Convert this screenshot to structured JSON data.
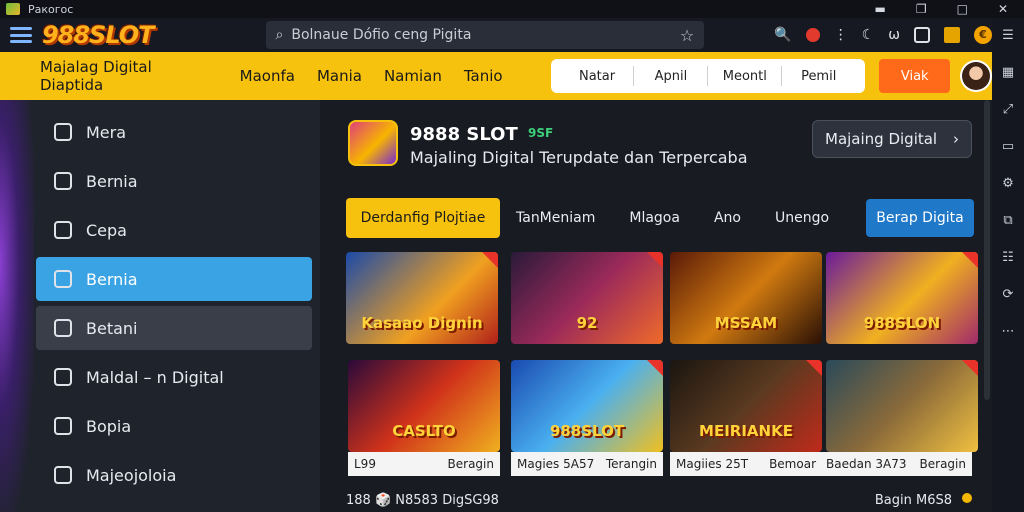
{
  "window": {
    "title": "Ракoгос",
    "controls": [
      "▬",
      "❐",
      "□",
      "✕"
    ]
  },
  "browser": {
    "logo": "988SLOT",
    "url_placeholder": "Bolnaue Dófio ceng Pigita",
    "star": "☆",
    "tools": [
      "🔍",
      "⋮",
      "☾",
      "ω"
    ]
  },
  "topnav": {
    "brand_text": "Majalag Digital Diaptida",
    "items": [
      "Maonfa",
      "Mania",
      "Namian",
      "Tanio"
    ],
    "pill": [
      "Natar",
      "Apnil",
      "Meontl",
      "Pemil"
    ],
    "cta": "Viak"
  },
  "sidebar": {
    "items": [
      {
        "label": "Mera"
      },
      {
        "label": "Bernia"
      },
      {
        "label": "Cepa"
      },
      {
        "label": "Bernia"
      },
      {
        "label": "Betani"
      },
      {
        "label": "Maldal – n Digital"
      },
      {
        "label": "Bopia"
      },
      {
        "label": "Majeojoloia"
      }
    ]
  },
  "header": {
    "title": "9888 SLOT",
    "tag": "9SF",
    "subtitle": "Majaling Digital Terupdate dan Terpercaba",
    "button": "Majaing Digital",
    "chevron": "›"
  },
  "tabs": [
    "Derdanfig Plojtiae",
    "TanMeniam",
    "Mlagoa",
    "Ano",
    "Unengo",
    "Berap Digita"
  ],
  "cards": [
    {
      "title": "Kasaao Dignin"
    },
    {
      "title": "92"
    },
    {
      "title": "MSSAM"
    },
    {
      "title": "988SLON"
    },
    {
      "title": "CASLTO"
    },
    {
      "title": "988SLOT"
    },
    {
      "title": "MEIRIANKE"
    },
    {
      "title": ""
    }
  ],
  "captions": [
    {
      "left": "L99",
      "right": "Beragin"
    },
    {
      "left": "Magies 5A57",
      "right": "Terangin"
    },
    {
      "left": "Magiies 25T",
      "right": "Bemoar"
    },
    {
      "left": "Baedan 3A73",
      "right": "Beragin"
    }
  ],
  "footer": {
    "left": "188 🎲 N8583 DigSG98",
    "right": "Bagin M6S8"
  }
}
